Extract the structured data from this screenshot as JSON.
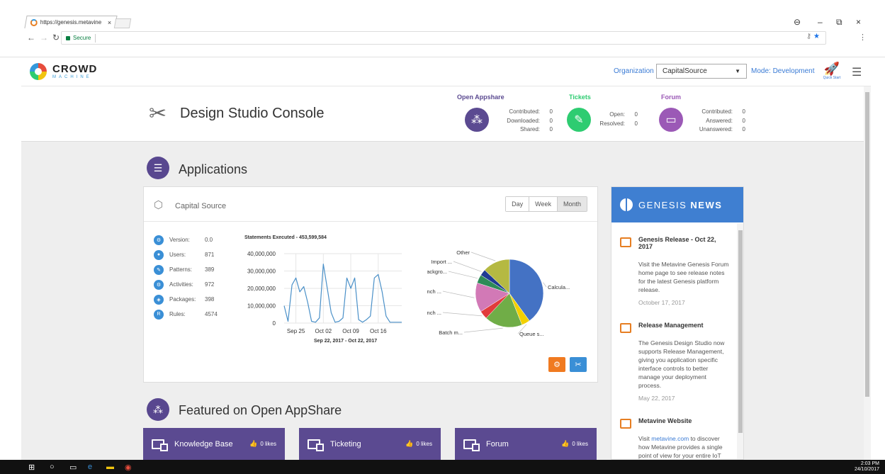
{
  "browser": {
    "tab_title": "https://genesis.metavine",
    "tab_close": "×",
    "secure_label": "Secure",
    "window_controls": [
      "⊖",
      "–",
      "⧉",
      "×"
    ],
    "icons": {
      "favicon": "metavine-favicon",
      "key": "key-icon",
      "star": "star-icon"
    }
  },
  "header": {
    "brand_main": "CROWD",
    "brand_sub": "MACHINE",
    "org_label": "Organization",
    "org_selected": "CapitalSource",
    "mode_label": "Mode: Development",
    "quick_start_label": "Quick Start"
  },
  "console": {
    "title": "Design Studio Console",
    "appshare": {
      "heading": "Open Appshare",
      "color": "#5b4a91",
      "stats": [
        {
          "label": "Contributed:",
          "value": "0"
        },
        {
          "label": "Downloaded:",
          "value": "0"
        },
        {
          "label": "Shared:",
          "value": "0"
        }
      ]
    },
    "tickets": {
      "heading": "Tickets",
      "color": "#2ecc71",
      "stats": [
        {
          "label": "Open:",
          "value": "0"
        },
        {
          "label": "Resolved:",
          "value": "0"
        }
      ]
    },
    "forum": {
      "heading": "Forum",
      "color": "#9b59b6",
      "stats": [
        {
          "label": "Contributed:",
          "value": "0"
        },
        {
          "label": "Answered:",
          "value": "0"
        },
        {
          "label": "Unanswered:",
          "value": "0"
        }
      ]
    }
  },
  "applications": {
    "title": "Applications",
    "card_title": "Capital Source",
    "periods": [
      "Day",
      "Week",
      "Month"
    ],
    "active_period": "Month",
    "metrics": [
      {
        "label": "Version:",
        "value": "0.0",
        "icon": "version-icon"
      },
      {
        "label": "Users:",
        "value": "871",
        "icon": "users-icon"
      },
      {
        "label": "Patterns:",
        "value": "389",
        "icon": "patterns-icon"
      },
      {
        "label": "Activities:",
        "value": "972",
        "icon": "activities-icon"
      },
      {
        "label": "Packages:",
        "value": "398",
        "icon": "packages-icon"
      },
      {
        "label": "Rules:",
        "value": "4574",
        "icon": "rules-icon"
      }
    ],
    "line_title": "Statements Executed - 453,599,584",
    "line_range": "Sep 22, 2017 - Oct 22, 2017",
    "action_colors": {
      "orange": "#f07a20",
      "blue": "#3a8fd6"
    }
  },
  "chart_data": [
    {
      "type": "line",
      "title": "Statements Executed - 453,599,584",
      "xlabel": "Sep 22, 2017 - Oct 22, 2017",
      "ylabel": "",
      "x_ticks": [
        "Sep 25",
        "Oct 02",
        "Oct 09",
        "Oct 16"
      ],
      "y_ticks": [
        "0",
        "10,000,000",
        "20,000,000",
        "30,000,000",
        "40,000,000"
      ],
      "ylim": [
        0,
        40000000
      ],
      "color": "#4a90c8",
      "x": [
        "2017-09-22",
        "2017-09-23",
        "2017-09-24",
        "2017-09-25",
        "2017-09-26",
        "2017-09-27",
        "2017-09-28",
        "2017-09-29",
        "2017-09-30",
        "2017-10-01",
        "2017-10-02",
        "2017-10-03",
        "2017-10-04",
        "2017-10-05",
        "2017-10-06",
        "2017-10-07",
        "2017-10-08",
        "2017-10-09",
        "2017-10-10",
        "2017-10-11",
        "2017-10-12",
        "2017-10-13",
        "2017-10-14",
        "2017-10-15",
        "2017-10-16",
        "2017-10-17",
        "2017-10-18",
        "2017-10-19",
        "2017-10-20",
        "2017-10-21",
        "2017-10-22"
      ],
      "values": [
        10000000,
        1000000,
        22000000,
        26000000,
        18000000,
        21000000,
        12000000,
        1000000,
        500000,
        3000000,
        34000000,
        20000000,
        6000000,
        500000,
        1000000,
        3000000,
        26000000,
        20000000,
        26000000,
        2000000,
        500000,
        2000000,
        4000000,
        26000000,
        28000000,
        18000000,
        4000000,
        500000,
        500000,
        500000,
        500000
      ]
    },
    {
      "type": "pie",
      "labels": [
        "Calcula...",
        "Queue s...",
        "Batch m...",
        "Launch ...",
        "Launch ...",
        "Backgro...",
        "Import ...",
        "Other"
      ],
      "values": [
        40,
        4,
        18,
        4,
        14,
        4,
        3,
        13
      ],
      "colors": [
        "#4472c4",
        "#f2d000",
        "#70ad47",
        "#e23b3b",
        "#d279b6",
        "#2e8b57",
        "#1f3a93",
        "#b5b942"
      ]
    }
  ],
  "news": {
    "brand": "GENESIS",
    "brand_suffix": "NEWS",
    "items": [
      {
        "title": "Genesis Release - Oct 22, 2017",
        "text": "Visit the Metavine Genesis Forum home page to see release notes for the latest Genesis platform release.",
        "date": "October 17, 2017",
        "icon": "calendar-icon"
      },
      {
        "title": "Release Management",
        "text": "The Genesis Design Studio now supports Release Management, giving you application specific interface controls to better manage your deployment process.",
        "date": "May 22, 2017",
        "icon": "tv-icon"
      },
      {
        "title": "Metavine Website",
        "text_pre": "Visit ",
        "link": "metavine.com",
        "text_post": " to discover how Metavine provides a single point of view for your entire IoT",
        "icon": "tv-icon"
      }
    ]
  },
  "featured": {
    "title": "Featured on Open AppShare",
    "cards": [
      {
        "label": "Knowledge Base",
        "likes": "0 likes"
      },
      {
        "label": "Ticketing",
        "likes": "0 likes"
      },
      {
        "label": "Forum",
        "likes": "0 likes"
      }
    ]
  },
  "taskbar": {
    "time": "2:03 PM",
    "date": "24/10/2017"
  }
}
